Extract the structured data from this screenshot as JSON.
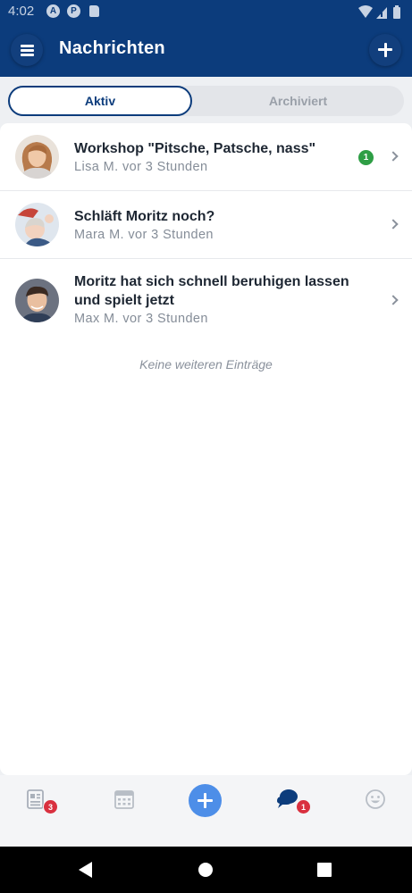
{
  "status_bar": {
    "time": "4:02",
    "icon_a": "A",
    "icon_p": "P"
  },
  "header": {
    "title": "Nachrichten"
  },
  "tabs": {
    "active": "Aktiv",
    "inactive": "Archiviert"
  },
  "messages": [
    {
      "title": "Workshop \"Pitsche, Patsche, nass\"",
      "subtitle": "Lisa M. vor 3 Stunden",
      "unread": "1"
    },
    {
      "title": "Schläft Moritz noch?",
      "subtitle": "Mara M. vor 3 Stunden"
    },
    {
      "title": "Moritz hat sich schnell beruhigen lassen und spielt jetzt",
      "subtitle": "Max M. vor 3 Stunden"
    }
  ],
  "empty_note": "Keine weiteren Einträge",
  "bottom_tabs": {
    "news_badge": "3",
    "messages_badge": "1"
  },
  "colors": {
    "primary": "#0c3c7c",
    "unread_green": "#2e9e45",
    "badge_red": "#d9303f",
    "fab_blue": "#4d8ee8"
  },
  "icons": [
    "hamburger-menu-icon",
    "plus-icon",
    "chevron-right-icon",
    "newspaper-icon",
    "calendar-icon",
    "chat-bubbles-icon",
    "smiley-icon"
  ]
}
